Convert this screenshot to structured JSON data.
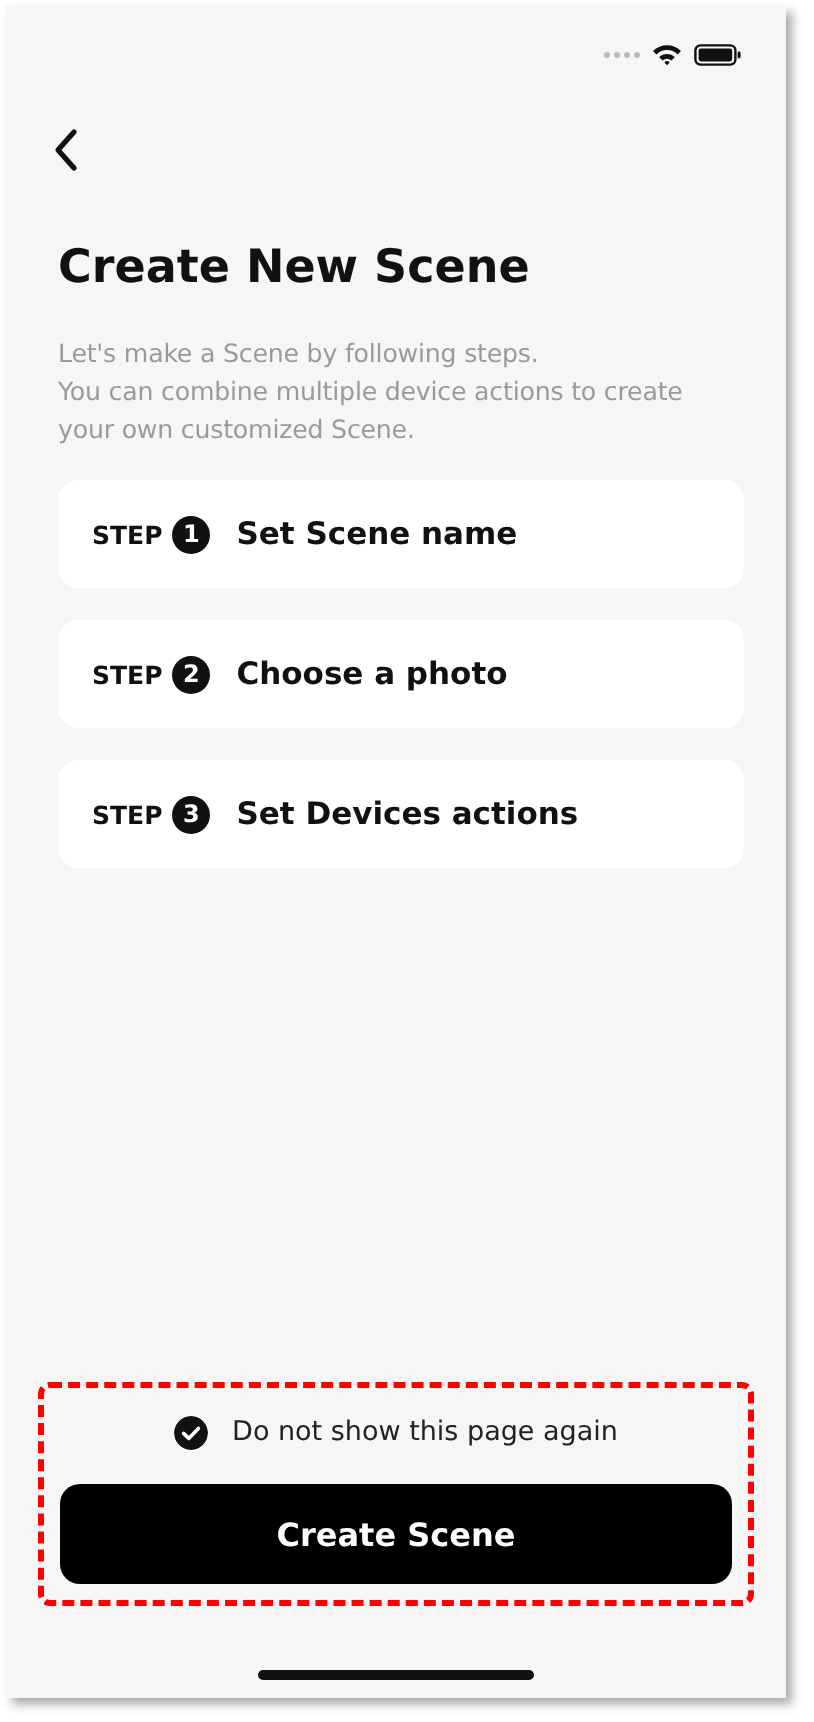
{
  "title": "Create New Scene",
  "description": [
    "Let's make a Scene by following steps.",
    "You can combine multiple device actions to create your own customized Scene."
  ],
  "steps": [
    {
      "label": "STEP",
      "number": "1",
      "text": "Set Scene name"
    },
    {
      "label": "STEP",
      "number": "2",
      "text": "Choose a photo"
    },
    {
      "label": "STEP",
      "number": "3",
      "text": "Set Devices actions"
    }
  ],
  "dont_show_again": {
    "label": "Do not show this page again",
    "checked": true
  },
  "create_button": {
    "label": "Create Scene"
  }
}
